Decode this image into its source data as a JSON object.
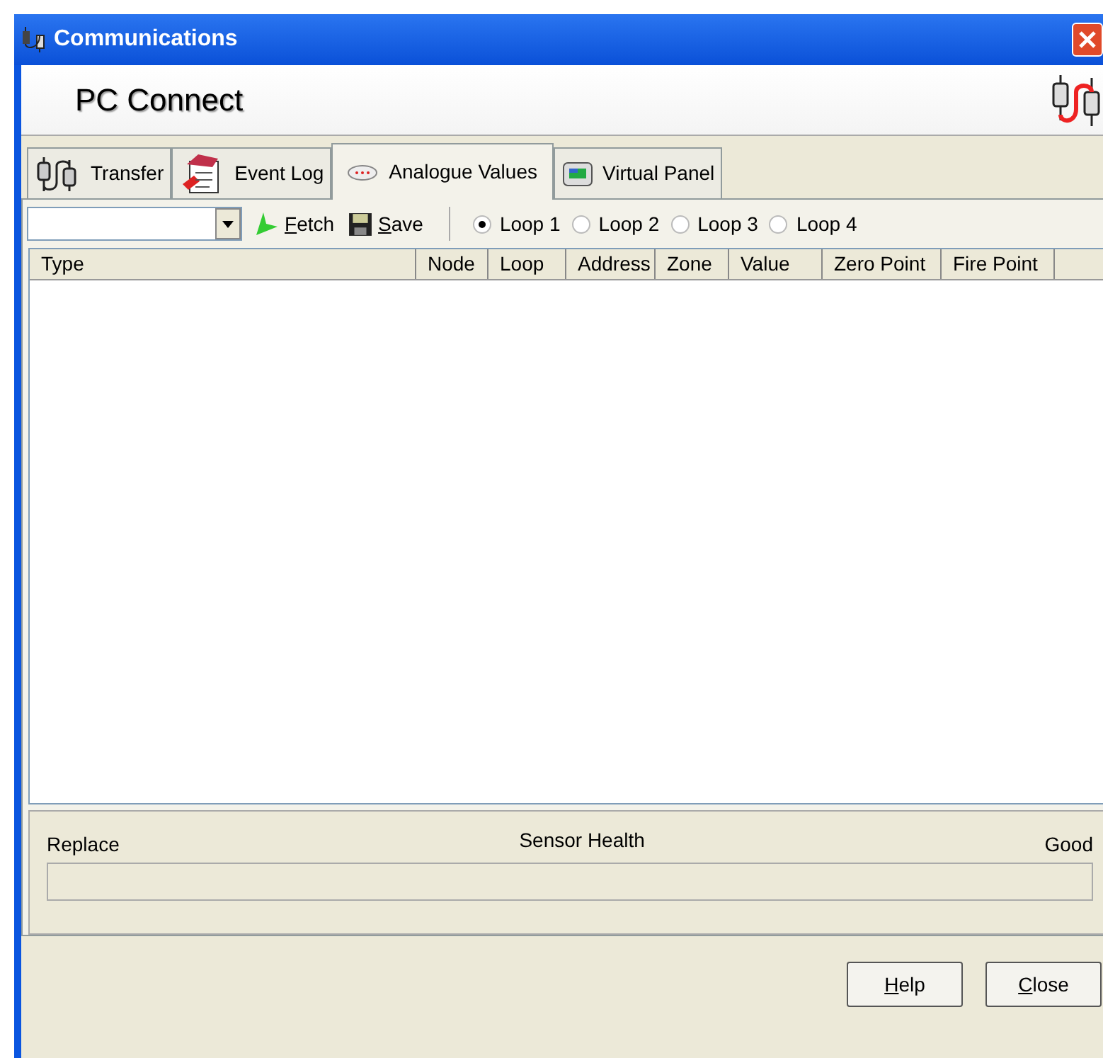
{
  "window": {
    "title": "Communications"
  },
  "header": {
    "title": "PC Connect"
  },
  "tabs": [
    {
      "label": "Transfer",
      "kind": "plugs",
      "selected": false
    },
    {
      "label": "Event Log",
      "kind": "log",
      "selected": false
    },
    {
      "label": "Analogue Values",
      "kind": "detector",
      "selected": true
    },
    {
      "label": "Virtual Panel",
      "kind": "panel",
      "selected": false
    }
  ],
  "toolbar": {
    "buttons": [
      {
        "label": "Fetch",
        "kind": "fetch"
      },
      {
        "label": "Save",
        "kind": "save"
      }
    ],
    "loops": [
      {
        "label": "Loop 1",
        "selected": true
      },
      {
        "label": "Loop 2",
        "selected": false
      },
      {
        "label": "Loop 3",
        "selected": false
      },
      {
        "label": "Loop 4",
        "selected": false
      }
    ]
  },
  "table": {
    "columns": [
      "Type",
      "Node",
      "Loop",
      "Address",
      "Zone",
      "Value",
      "Zero Point",
      "Fire Point"
    ]
  },
  "sensor_health": {
    "title": "Sensor Health",
    "left_label": "Replace",
    "right_label": "Good"
  },
  "buttons": [
    "Help",
    "Close"
  ]
}
